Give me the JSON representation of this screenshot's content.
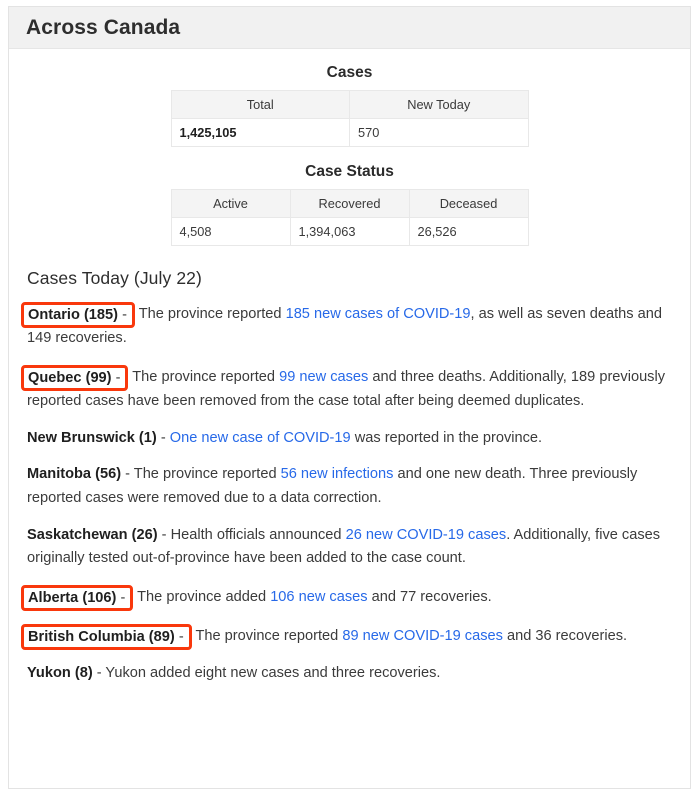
{
  "header": {
    "title": "Across Canada"
  },
  "tables": [
    {
      "caption": "Cases",
      "columns": [
        "Total",
        "New Today"
      ],
      "values": [
        "1,425,105",
        "570"
      ],
      "bold_first": true
    },
    {
      "caption": "Case Status",
      "columns": [
        "Active",
        "Recovered",
        "Deceased"
      ],
      "values": [
        "4,508",
        "1,394,063",
        "26,526"
      ],
      "bold_first": false
    }
  ],
  "today": {
    "heading": "Cases Today (July 22)",
    "entries": [
      {
        "province_label": "Ontario (185)",
        "dash": "-",
        "highlighted": true,
        "before_link": "The province reported ",
        "link": "185 new cases of COVID-19",
        "after_link": ", as well as seven deaths and 149 recoveries."
      },
      {
        "province_label": "Quebec (99)",
        "dash": "-",
        "highlighted": true,
        "before_link": "The province reported ",
        "link": "99 new cases",
        "after_link": " and three deaths. Additionally, 189 previously reported cases have been removed from the case total after being deemed duplicates."
      },
      {
        "province_label": "New Brunswick (1)",
        "dash": "-",
        "highlighted": false,
        "before_link": "",
        "link": "One new case of COVID-19",
        "after_link": " was reported in the province."
      },
      {
        "province_label": "Manitoba (56)",
        "dash": "-",
        "highlighted": false,
        "before_link": "The province reported ",
        "link": "56 new infections",
        "after_link": " and one new death. Three previously reported cases were removed due to a data correction."
      },
      {
        "province_label": "Saskatchewan (26)",
        "dash": "-",
        "highlighted": false,
        "before_link": "Health officials announced ",
        "link": "26 new COVID-19 cases",
        "after_link": ". Additionally, five cases originally tested out-of-province have been added to the case count."
      },
      {
        "province_label": "Alberta (106)",
        "dash": "-",
        "highlighted": true,
        "before_link": "The province added ",
        "link": "106 new cases",
        "after_link": " and 77 recoveries."
      },
      {
        "province_label": "British Columbia (89)",
        "dash": "-",
        "highlighted": true,
        "before_link": "The province reported ",
        "link": "89 new COVID-19 cases",
        "after_link": " and 36 recoveries."
      },
      {
        "province_label": "Yukon (8)",
        "dash": "-",
        "highlighted": false,
        "before_link": "Yukon added eight new cases and three recoveries.",
        "link": "",
        "after_link": ""
      }
    ]
  },
  "colors": {
    "highlight_box": "#f9380c",
    "link": "#2769e8",
    "header_bg": "#f1f1f1",
    "table_header_bg": "#f4f4f4",
    "border": "#e8e8e8"
  }
}
